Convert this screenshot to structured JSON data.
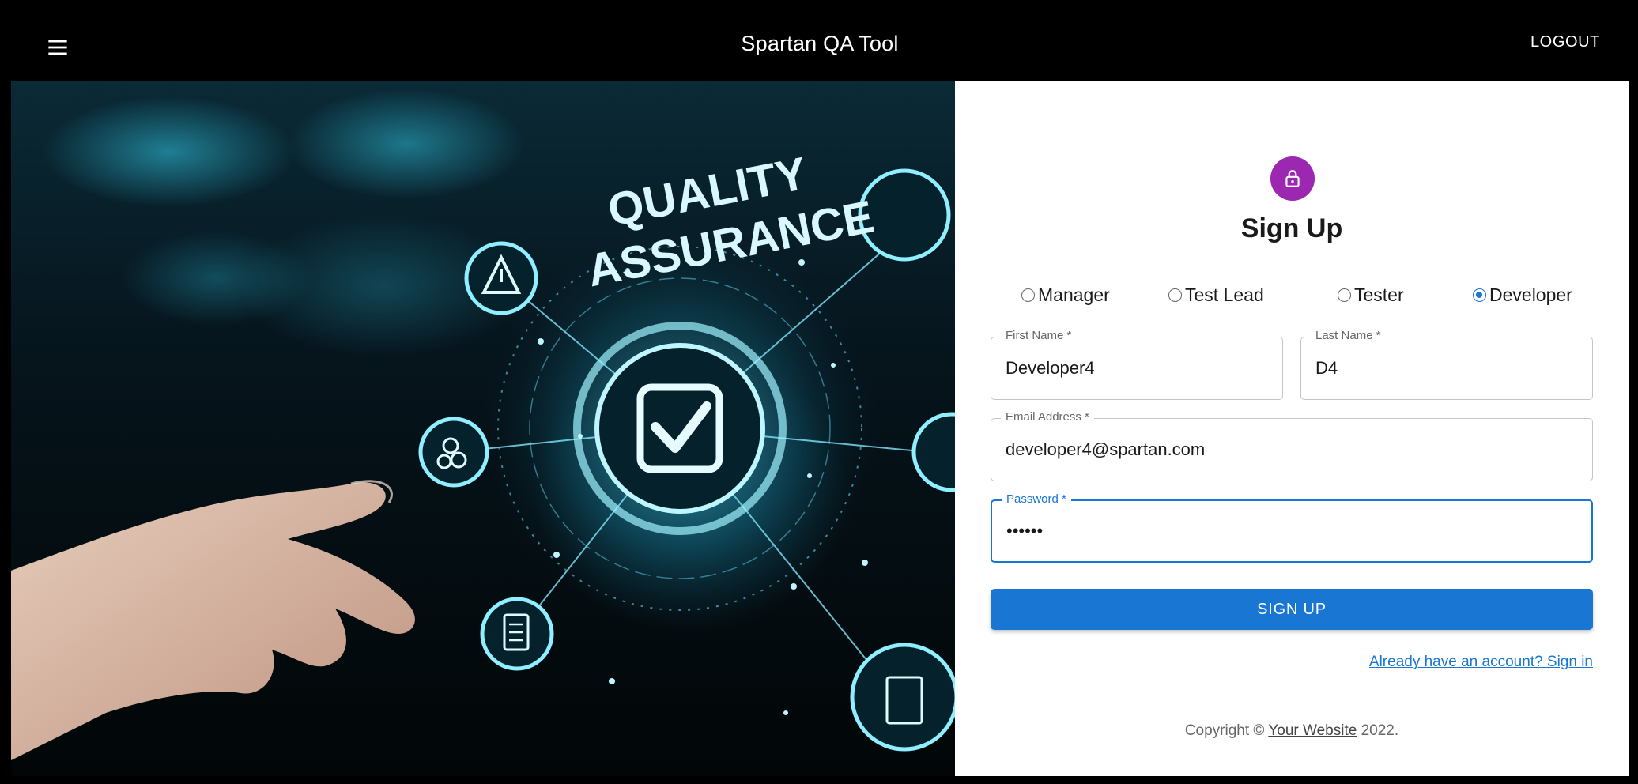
{
  "app": {
    "title": "Spartan QA Tool",
    "logout_label": "LOGOUT"
  },
  "hero": {
    "text_line1": "QUALITY",
    "text_line2": "ASSURANCE"
  },
  "form": {
    "title": "Sign Up",
    "roles": [
      {
        "label": "Manager",
        "checked": false
      },
      {
        "label": "Test Lead",
        "checked": false
      },
      {
        "label": "Tester",
        "checked": false
      },
      {
        "label": "Developer",
        "checked": true
      }
    ],
    "first_name": {
      "label": "First Name *",
      "value": "Developer4"
    },
    "last_name": {
      "label": "Last Name *",
      "value": "D4"
    },
    "email": {
      "label": "Email Address *",
      "value": "developer4@spartan.com"
    },
    "password": {
      "label": "Password *",
      "value": "••••••"
    },
    "submit_label": "SIGN UP",
    "signin_link": "Already have an account? Sign in"
  },
  "footer": {
    "prefix": "Copyright © ",
    "link": "Your Website",
    "suffix": " 2022."
  },
  "colors": {
    "primary": "#1976d2",
    "avatar": "#9c27b0",
    "appbar": "#000000"
  },
  "icons": {
    "menu": "menu-icon",
    "lock": "lock-icon"
  }
}
